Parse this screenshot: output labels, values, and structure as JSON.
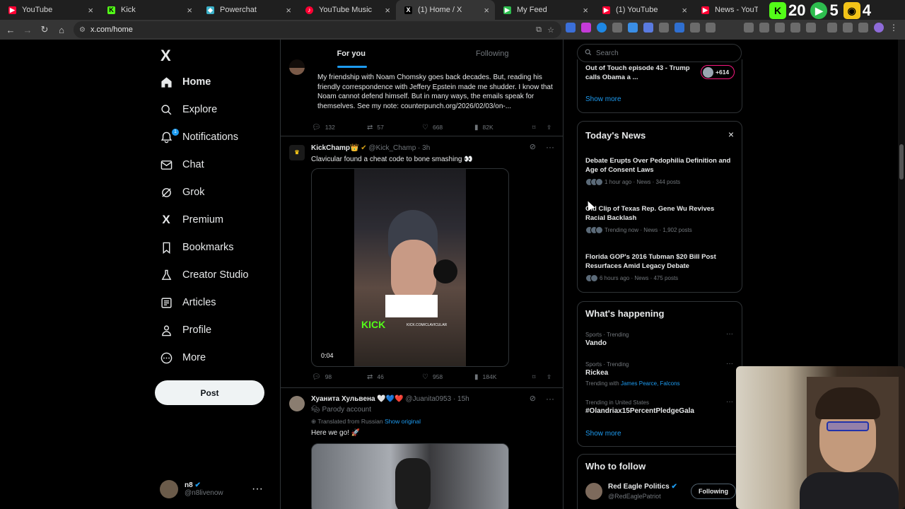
{
  "browser": {
    "tabs": [
      {
        "title": "YouTube",
        "color": "#ff0033",
        "glyph": "▶"
      },
      {
        "title": "Kick",
        "color": "#53fc18",
        "glyph": "K"
      },
      {
        "title": "Powerchat",
        "color": "#3ab0c8",
        "glyph": "◆"
      },
      {
        "title": "YouTube Music",
        "color": "#ff0033",
        "glyph": "♪"
      },
      {
        "title": "(1) Home / X",
        "color": "#000000",
        "glyph": "X"
      },
      {
        "title": "My Feed",
        "color": "#2dbd4e",
        "glyph": "▶"
      },
      {
        "title": "(1) YouTube",
        "color": "#ff0033",
        "glyph": "▶"
      },
      {
        "title": "News - YouTube",
        "color": "#ff0033",
        "glyph": "▶"
      }
    ],
    "url": "x.com/home",
    "counters": [
      {
        "value": "20"
      },
      {
        "value": "5"
      },
      {
        "value": "4"
      }
    ]
  },
  "nav": {
    "logo": "X",
    "items": [
      {
        "label": "Home",
        "icon": "home-icon"
      },
      {
        "label": "Explore",
        "icon": "search-icon"
      },
      {
        "label": "Notifications",
        "icon": "bell-icon"
      },
      {
        "label": "Chat",
        "icon": "mail-icon"
      },
      {
        "label": "Grok",
        "icon": "grok-icon"
      },
      {
        "label": "Premium",
        "icon": "x-icon"
      },
      {
        "label": "Bookmarks",
        "icon": "bookmark-icon"
      },
      {
        "label": "Creator Studio",
        "icon": "flask-icon"
      },
      {
        "label": "Articles",
        "icon": "article-icon"
      },
      {
        "label": "Profile",
        "icon": "person-icon"
      },
      {
        "label": "More",
        "icon": "more-icon"
      }
    ],
    "notif_badge": "1",
    "post_label": "Post",
    "account": {
      "name": "n8",
      "handle": "@n8livenow"
    }
  },
  "feed": {
    "tabs": [
      "For you",
      "Following"
    ],
    "tweets": [
      {
        "text": "My friendship with Noam Chomsky goes back decades. But, reading his friendly correspondence with Jeffery Epstein made me shudder. I know that Noam cannot defend himself. But in many ways, the emails speak for themselves. See my note: counterpunch.org/2026/02/03/on-...",
        "replies": "132",
        "reposts": "57",
        "likes": "668",
        "views": "82K"
      },
      {
        "name": "KickChamp👑",
        "handle": "@Kick_Champ",
        "time": "· 3h",
        "text": "Clavicular found a cheat code to bone smashing 👀",
        "video_time": "0:04",
        "overlay_brand": "KICK",
        "overlay_caption": "KICK.COM/CLAVICULAR",
        "replies": "98",
        "reposts": "46",
        "likes": "958",
        "views": "184K"
      },
      {
        "name": "Хуанита Хульвена 🤍💙❤️",
        "handle": "@Juanita0953",
        "time": "· 15h",
        "parody": "Parody account",
        "translated": "Translated from Russian",
        "show_original": "Show original",
        "text": "Here we go! 🚀"
      }
    ]
  },
  "sidebar": {
    "search_placeholder": "Search",
    "top_item": {
      "title": "Out of Touch episode 43 - Trump calls Obama a ...",
      "count": "+614"
    },
    "show_more": "Show more",
    "todays_news": {
      "title": "Today's News",
      "items": [
        {
          "title": "Debate Erupts Over Pedophilia Definition and Age of Consent Laws",
          "meta": "1 hour ago · News · 344 posts"
        },
        {
          "title": "Old Clip of Texas Rep. Gene Wu Revives Racial Backlash",
          "meta": "Trending now · News · 1,902 posts"
        },
        {
          "title": "Florida GOP's 2016 Tubman $20 Bill Post Resurfaces Amid Legacy Debate",
          "meta": "6 hours ago · News · 475 posts"
        }
      ]
    },
    "whats_happening": {
      "title": "What's happening",
      "items": [
        {
          "category": "Sports · Trending",
          "name": "Vando"
        },
        {
          "category": "Sports · Trending",
          "name": "Rickea",
          "with_label": "Trending with",
          "with_links": "James Pearce, Falcons"
        },
        {
          "category": "Trending in United States",
          "name": "#Olandriax15PercentPledgeGala"
        }
      ],
      "show_more": "Show more"
    },
    "who_to_follow": {
      "title": "Who to follow",
      "user": {
        "name": "Red Eagle Politics",
        "handle": "@RedEaglePatriot",
        "button": "Following"
      }
    }
  }
}
